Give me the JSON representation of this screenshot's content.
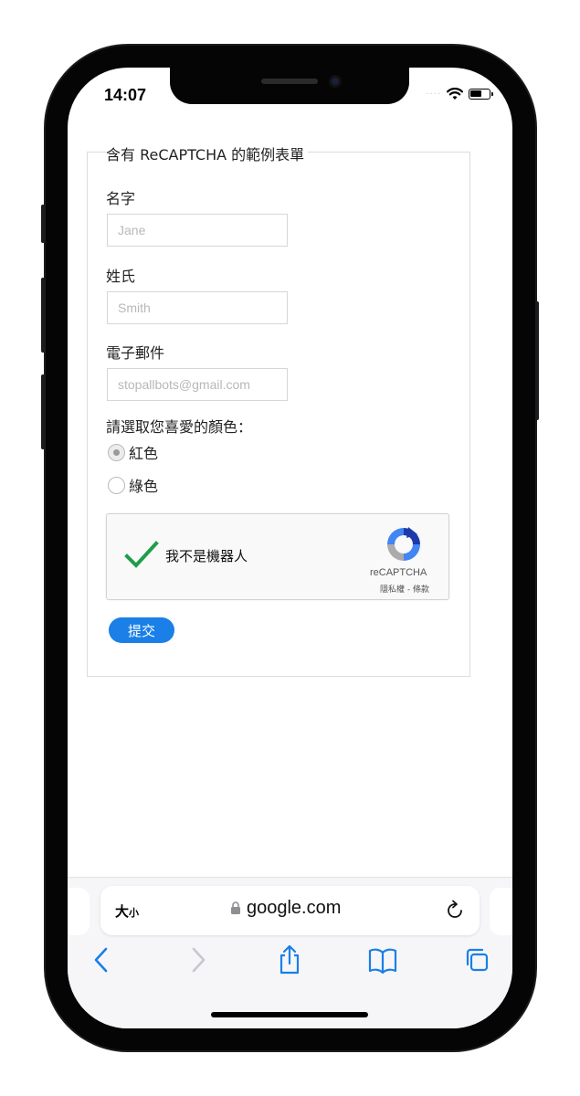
{
  "status_bar": {
    "time": "14:07",
    "signal": "····"
  },
  "form": {
    "legend": "含有 ReCAPTCHA 的範例表單",
    "fields": [
      {
        "label": "名字",
        "placeholder": "Jane"
      },
      {
        "label": "姓氏",
        "placeholder": "Smith"
      },
      {
        "label": "電子郵件",
        "placeholder": "stopallbots@gmail.com"
      }
    ],
    "color_question": "請選取您喜愛的顏色：",
    "options": [
      {
        "label": "紅色",
        "checked": true
      },
      {
        "label": "綠色",
        "checked": false
      }
    ],
    "recaptcha": {
      "label": "我不是機器人",
      "brand": "reCAPTCHA",
      "terms": "隱私權 - 條款"
    },
    "submit_label": "提交"
  },
  "browser": {
    "text_size": "大",
    "text_size_small": "小",
    "url": "google.com"
  },
  "colors": {
    "accent": "#1a7fe6",
    "check": "#1e9e4a",
    "toolbar_icon": "#1a7fe6"
  }
}
